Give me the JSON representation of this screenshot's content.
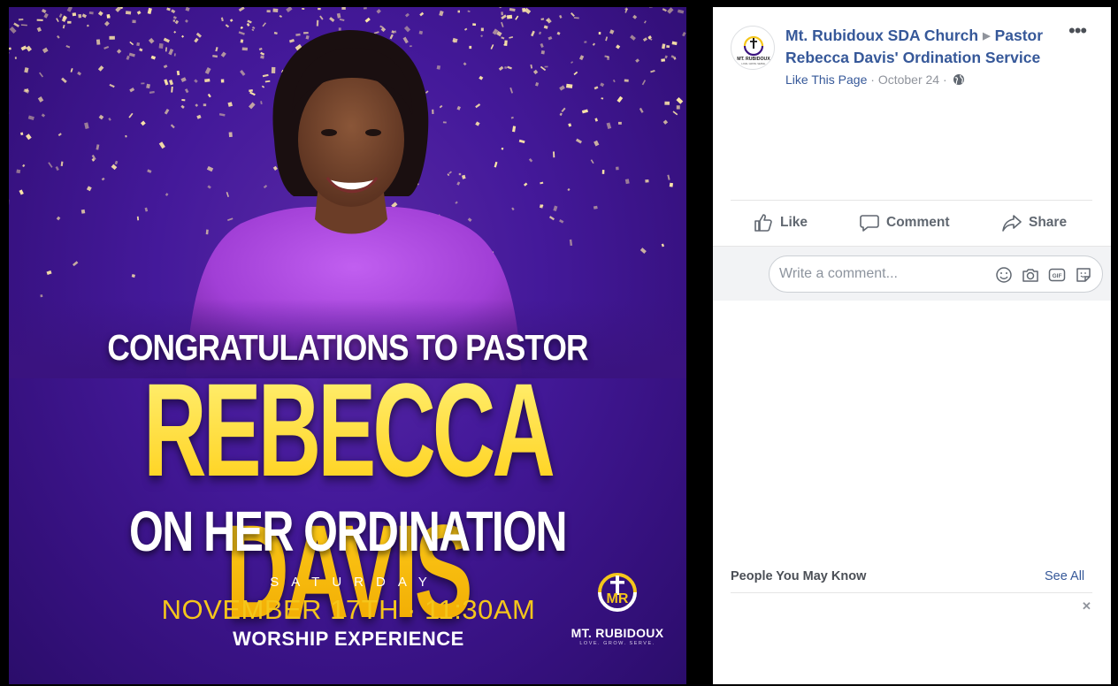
{
  "flyer": {
    "headline_1": "CONGRATULATIONS TO PASTOR",
    "headline_name": "REBECCA DAVIS",
    "headline_2": "ON HER ORDINATION",
    "day": "SATURDAY",
    "date_time": "NOVEMBER 17TH · 11:30AM",
    "event": "WORSHIP EXPERIENCE",
    "logo_initials": "MR",
    "logo_name": "MT. RUBIDOUX",
    "logo_tagline": "LOVE. GROW. SERVE.",
    "colors": {
      "background": "#3a137f",
      "name_gold": "#ffd21f",
      "date_gold": "#f5c61b",
      "dress": "#b24fe0"
    }
  },
  "post": {
    "avatar": {
      "name": "MT. RUBIDOUX",
      "tagline": "LOVE. GROW. SERVE."
    },
    "page_name": "Mt. Rubidoux SDA Church",
    "separator_icon": "triangle-right-icon",
    "album_name": "Pastor Rebecca Davis' Ordination Service",
    "more_label": "•••",
    "like_page_label": "Like This Page",
    "dot": "·",
    "date": "October 24",
    "privacy_icon": "globe-icon"
  },
  "actions": {
    "like_label": "Like",
    "comment_label": "Comment",
    "share_label": "Share"
  },
  "comment": {
    "placeholder": "Write a comment...",
    "icons": [
      "emoji-icon",
      "camera-icon",
      "gif-icon",
      "sticker-icon"
    ],
    "gif_label": "GIF"
  },
  "pymk": {
    "title": "People You May Know",
    "see_all_label": "See All",
    "close_label": "✕"
  },
  "theme": {
    "link_blue": "#365899",
    "text_gray": "#606770",
    "meta_gray": "#90949c"
  }
}
